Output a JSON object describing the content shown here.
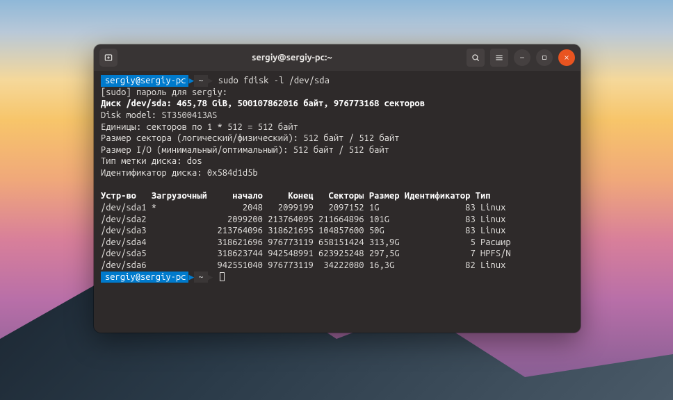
{
  "window": {
    "title": "sergiy@sergiy-pc:~"
  },
  "prompt": {
    "user_host": "sergiy@sergiy-pc",
    "path": "~"
  },
  "command": "sudo fdisk -l /dev/sda",
  "sudo_line": "[sudo] пароль для sergiy:",
  "disk": {
    "summary": "Диск /dev/sda: 465,78 GiB, 500107862016 байт, 976773168 секторов",
    "model": "Disk model: ST3500413AS",
    "units": "Единицы: секторов по 1 * 512 = 512 байт",
    "sector_size": "Размер сектора (логический/физический): 512 байт / 512 байт",
    "io_size": "Размер I/O (минимальный/оптимальный): 512 байт / 512 байт",
    "label_type": "Тип метки диска: dos",
    "identifier": "Идентификатор диска: 0x584d1d5b"
  },
  "table": {
    "headers": {
      "device": "Устр-во",
      "boot": "Загрузочный",
      "start": "начало",
      "end": "Конец",
      "sectors": "Секторы",
      "size": "Размер",
      "id": "Идентификатор",
      "type": "Тип"
    },
    "rows": [
      {
        "dev": "/dev/sda1",
        "boot": "*",
        "start": "2048",
        "end": "2099199",
        "sectors": "2097152",
        "size": "1G",
        "id": "83",
        "type": "Linux"
      },
      {
        "dev": "/dev/sda2",
        "boot": "",
        "start": "2099200",
        "end": "213764095",
        "sectors": "211664896",
        "size": "101G",
        "id": "83",
        "type": "Linux"
      },
      {
        "dev": "/dev/sda3",
        "boot": "",
        "start": "213764096",
        "end": "318621695",
        "sectors": "104857600",
        "size": "50G",
        "id": "83",
        "type": "Linux"
      },
      {
        "dev": "/dev/sda4",
        "boot": "",
        "start": "318621696",
        "end": "976773119",
        "sectors": "658151424",
        "size": "313,9G",
        "id": "5",
        "type": "Расшир"
      },
      {
        "dev": "/dev/sda5",
        "boot": "",
        "start": "318623744",
        "end": "942548991",
        "sectors": "623925248",
        "size": "297,5G",
        "id": "7",
        "type": "HPFS/N"
      },
      {
        "dev": "/dev/sda6",
        "boot": "",
        "start": "942551040",
        "end": "976773119",
        "sectors": "34222080",
        "size": "16,3G",
        "id": "82",
        "type": "Linux"
      }
    ]
  },
  "icons": {
    "newtab": "new-tab-icon",
    "search": "search-icon",
    "menu": "hamburger-icon",
    "minimize": "minimize-icon",
    "maximize": "maximize-icon",
    "close": "close-icon"
  }
}
